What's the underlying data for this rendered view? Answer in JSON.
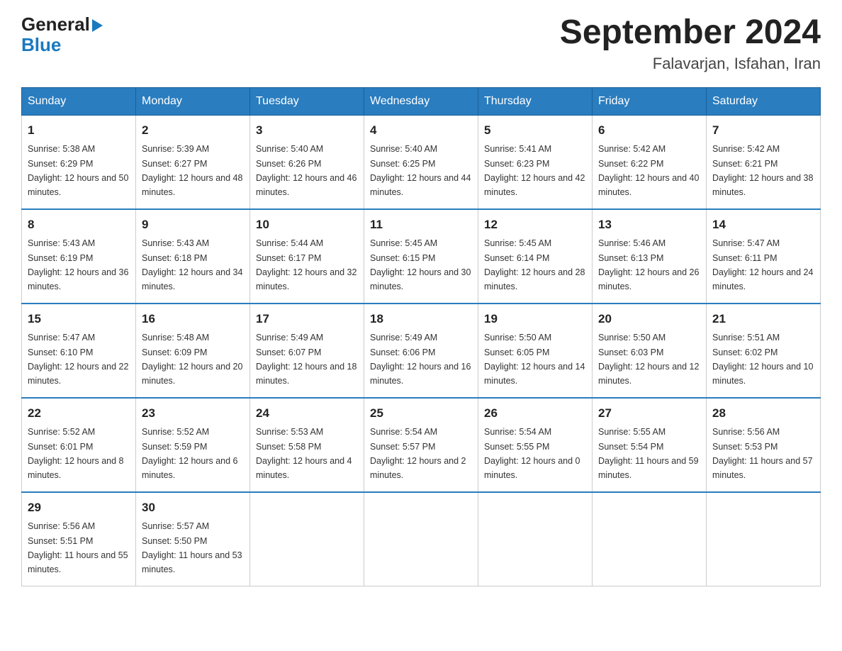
{
  "header": {
    "logo_line1": "General",
    "logo_line2": "Blue",
    "month_title": "September 2024",
    "location": "Falavarjan, Isfahan, Iran"
  },
  "weekdays": [
    "Sunday",
    "Monday",
    "Tuesday",
    "Wednesday",
    "Thursday",
    "Friday",
    "Saturday"
  ],
  "weeks": [
    [
      {
        "day": "1",
        "sunrise": "5:38 AM",
        "sunset": "6:29 PM",
        "daylight": "12 hours and 50 minutes."
      },
      {
        "day": "2",
        "sunrise": "5:39 AM",
        "sunset": "6:27 PM",
        "daylight": "12 hours and 48 minutes."
      },
      {
        "day": "3",
        "sunrise": "5:40 AM",
        "sunset": "6:26 PM",
        "daylight": "12 hours and 46 minutes."
      },
      {
        "day": "4",
        "sunrise": "5:40 AM",
        "sunset": "6:25 PM",
        "daylight": "12 hours and 44 minutes."
      },
      {
        "day": "5",
        "sunrise": "5:41 AM",
        "sunset": "6:23 PM",
        "daylight": "12 hours and 42 minutes."
      },
      {
        "day": "6",
        "sunrise": "5:42 AM",
        "sunset": "6:22 PM",
        "daylight": "12 hours and 40 minutes."
      },
      {
        "day": "7",
        "sunrise": "5:42 AM",
        "sunset": "6:21 PM",
        "daylight": "12 hours and 38 minutes."
      }
    ],
    [
      {
        "day": "8",
        "sunrise": "5:43 AM",
        "sunset": "6:19 PM",
        "daylight": "12 hours and 36 minutes."
      },
      {
        "day": "9",
        "sunrise": "5:43 AM",
        "sunset": "6:18 PM",
        "daylight": "12 hours and 34 minutes."
      },
      {
        "day": "10",
        "sunrise": "5:44 AM",
        "sunset": "6:17 PM",
        "daylight": "12 hours and 32 minutes."
      },
      {
        "day": "11",
        "sunrise": "5:45 AM",
        "sunset": "6:15 PM",
        "daylight": "12 hours and 30 minutes."
      },
      {
        "day": "12",
        "sunrise": "5:45 AM",
        "sunset": "6:14 PM",
        "daylight": "12 hours and 28 minutes."
      },
      {
        "day": "13",
        "sunrise": "5:46 AM",
        "sunset": "6:13 PM",
        "daylight": "12 hours and 26 minutes."
      },
      {
        "day": "14",
        "sunrise": "5:47 AM",
        "sunset": "6:11 PM",
        "daylight": "12 hours and 24 minutes."
      }
    ],
    [
      {
        "day": "15",
        "sunrise": "5:47 AM",
        "sunset": "6:10 PM",
        "daylight": "12 hours and 22 minutes."
      },
      {
        "day": "16",
        "sunrise": "5:48 AM",
        "sunset": "6:09 PM",
        "daylight": "12 hours and 20 minutes."
      },
      {
        "day": "17",
        "sunrise": "5:49 AM",
        "sunset": "6:07 PM",
        "daylight": "12 hours and 18 minutes."
      },
      {
        "day": "18",
        "sunrise": "5:49 AM",
        "sunset": "6:06 PM",
        "daylight": "12 hours and 16 minutes."
      },
      {
        "day": "19",
        "sunrise": "5:50 AM",
        "sunset": "6:05 PM",
        "daylight": "12 hours and 14 minutes."
      },
      {
        "day": "20",
        "sunrise": "5:50 AM",
        "sunset": "6:03 PM",
        "daylight": "12 hours and 12 minutes."
      },
      {
        "day": "21",
        "sunrise": "5:51 AM",
        "sunset": "6:02 PM",
        "daylight": "12 hours and 10 minutes."
      }
    ],
    [
      {
        "day": "22",
        "sunrise": "5:52 AM",
        "sunset": "6:01 PM",
        "daylight": "12 hours and 8 minutes."
      },
      {
        "day": "23",
        "sunrise": "5:52 AM",
        "sunset": "5:59 PM",
        "daylight": "12 hours and 6 minutes."
      },
      {
        "day": "24",
        "sunrise": "5:53 AM",
        "sunset": "5:58 PM",
        "daylight": "12 hours and 4 minutes."
      },
      {
        "day": "25",
        "sunrise": "5:54 AM",
        "sunset": "5:57 PM",
        "daylight": "12 hours and 2 minutes."
      },
      {
        "day": "26",
        "sunrise": "5:54 AM",
        "sunset": "5:55 PM",
        "daylight": "12 hours and 0 minutes."
      },
      {
        "day": "27",
        "sunrise": "5:55 AM",
        "sunset": "5:54 PM",
        "daylight": "11 hours and 59 minutes."
      },
      {
        "day": "28",
        "sunrise": "5:56 AM",
        "sunset": "5:53 PM",
        "daylight": "11 hours and 57 minutes."
      }
    ],
    [
      {
        "day": "29",
        "sunrise": "5:56 AM",
        "sunset": "5:51 PM",
        "daylight": "11 hours and 55 minutes."
      },
      {
        "day": "30",
        "sunrise": "5:57 AM",
        "sunset": "5:50 PM",
        "daylight": "11 hours and 53 minutes."
      },
      null,
      null,
      null,
      null,
      null
    ]
  ]
}
